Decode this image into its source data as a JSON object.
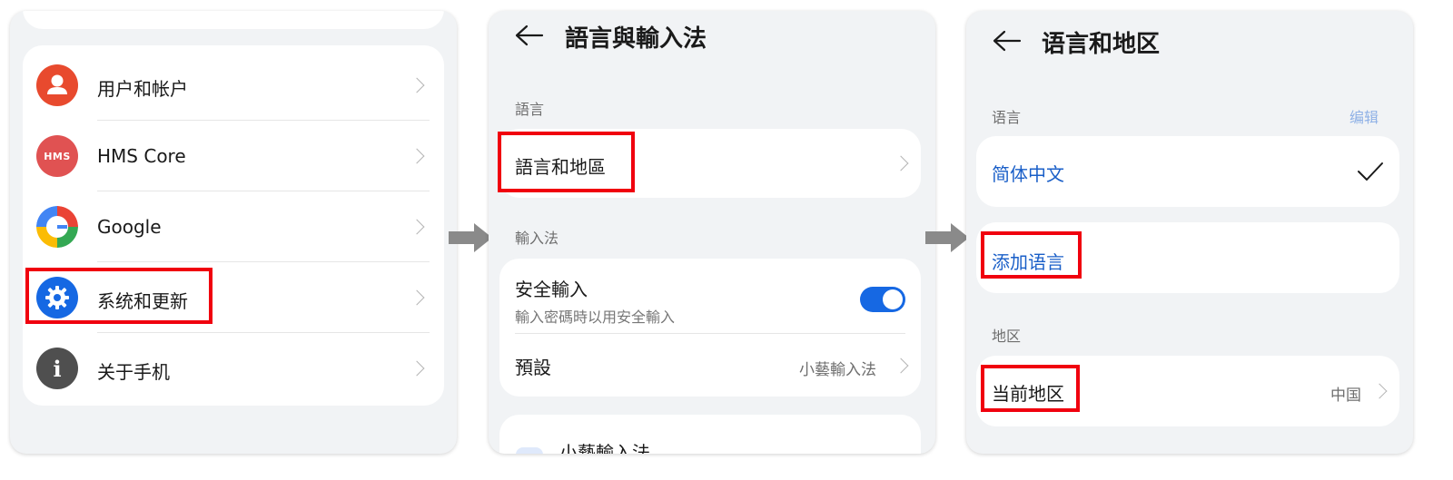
{
  "panel1": {
    "items": [
      {
        "label": "用户和帐户",
        "icon": "user-icon",
        "color": "#e84a2e"
      },
      {
        "label": "HMS Core",
        "icon": "hms-icon",
        "color": "#e04a4a",
        "icon_text": "HMS"
      },
      {
        "label": "Google",
        "icon": "google-icon"
      },
      {
        "label": "系统和更新",
        "icon": "gear-icon",
        "color": "#1668e3"
      },
      {
        "label": "关于手机",
        "icon": "info-icon",
        "color": "#4f4f4f",
        "icon_text": "i"
      }
    ]
  },
  "panel2": {
    "title": "語言與輸入法",
    "section_language": "語言",
    "language_region": "語言和地區",
    "section_input": "輸入法",
    "secure_input": "安全輸入",
    "secure_input_sub": "輸入密碼時以用安全輸入",
    "default_label": "預設",
    "default_value": "小藝輸入法",
    "bottom_item": "小藝輸入法",
    "toggle_on": true,
    "toggle_color": "#1668e3"
  },
  "panel3": {
    "title": "语言和地区",
    "section_language": "语言",
    "edit": "编辑",
    "current_language": "简体中文",
    "add_language": "添加语言",
    "section_region": "地区",
    "current_region": "当前地区",
    "region_value": "中国"
  },
  "colors": {
    "highlight": "#f0000e",
    "accent": "#1a5fc8",
    "panel_bg": "#f1f3f5"
  }
}
